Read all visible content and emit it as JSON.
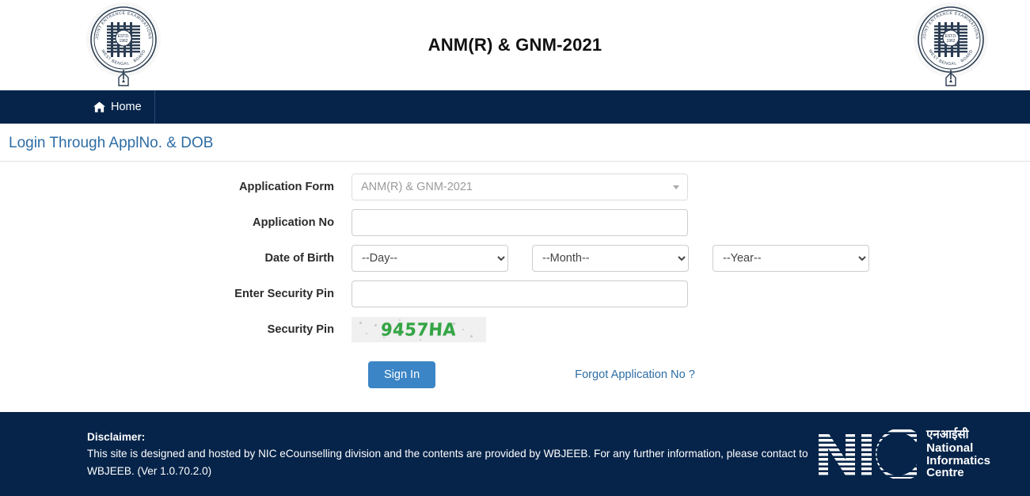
{
  "header": {
    "title": "ANM(R) & GNM-2021",
    "left_seal_name": "wbjeeb-seal-left",
    "right_seal_name": "wbjeeb-seal-right",
    "seal_text_outer": "WEST BENGAL JOINT ENTRANCE EXAMINATIONS BOARD",
    "seal_text_inner_1": "ESTD.",
    "seal_text_inner_2": "1962"
  },
  "navbar": {
    "items": [
      {
        "label": "Home",
        "icon": "home-icon"
      }
    ]
  },
  "page": {
    "title": "Login Through ApplNo. & DOB"
  },
  "form": {
    "application_form": {
      "label": "Application Form",
      "value": "ANM(R) & GNM-2021"
    },
    "application_no": {
      "label": "Application No",
      "value": "",
      "placeholder": ""
    },
    "date_of_birth": {
      "label": "Date of Birth",
      "day": "--Day--",
      "month": "--Month--",
      "year": "--Year--"
    },
    "enter_security_pin": {
      "label": "Enter Security Pin",
      "value": "",
      "placeholder": ""
    },
    "security_pin": {
      "label": "Security Pin",
      "captcha_text": "9457HA",
      "captcha_color": "#33a544"
    },
    "actions": {
      "signin_label": "Sign In",
      "forgot_label": "Forgot Application No ?"
    }
  },
  "footer": {
    "disclaimer_title": "Disclaimer:",
    "disclaimer_text": "This site is designed and hosted by NIC eCounselling division and the contents are provided by WBJEEB. For any further information, please contact to WBJEEB. (Ver 1.0.70.2.0)",
    "nic": {
      "mark": "NIC",
      "hindi": "एनआईसी",
      "line1": "National",
      "line2": "Informatics",
      "line3": "Centre"
    }
  },
  "colors": {
    "navy": "#06244a",
    "accent_blue": "#2e6da4",
    "button_blue": "#3b85c6",
    "captcha_green": "#33a544"
  }
}
